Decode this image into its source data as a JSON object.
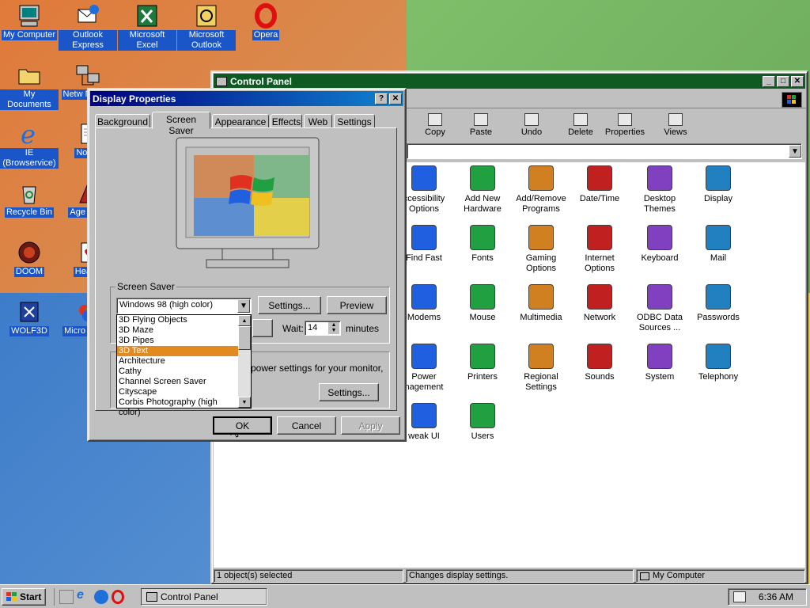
{
  "desktop": {
    "icons": [
      {
        "label": "My Computer",
        "icon": "my-computer-icon"
      },
      {
        "label": "Outlook Express",
        "icon": "outlook-express-icon"
      },
      {
        "label": "Microsoft Excel",
        "icon": "excel-icon"
      },
      {
        "label": "Microsoft Outlook",
        "icon": "outlook-icon"
      },
      {
        "label": "Opera",
        "icon": "opera-icon"
      },
      {
        "label": "My Documents",
        "icon": "folder-icon"
      },
      {
        "label": "Netw Neighb",
        "icon": "network-neighborhood-icon"
      },
      {
        "label": "IE (Browservice)",
        "icon": "ie-icon"
      },
      {
        "label": "Notep",
        "icon": "notepad-icon"
      },
      {
        "label": "Recycle Bin",
        "icon": "recycle-bin-icon"
      },
      {
        "label": "Age Emp",
        "icon": "age-of-empires-icon"
      },
      {
        "label": "DOOM",
        "icon": "doom-icon"
      },
      {
        "label": "Hearts",
        "icon": "hearts-icon"
      },
      {
        "label": "WOLF3D",
        "icon": "wolf3d-icon"
      },
      {
        "label": "Micro Visual",
        "icon": "visual-icon"
      }
    ]
  },
  "control_panel": {
    "title": "Control Panel",
    "toolbar": [
      {
        "label": "Copy",
        "icon": "copy-icon"
      },
      {
        "label": "Paste",
        "icon": "paste-icon"
      },
      {
        "label": "Undo",
        "icon": "undo-icon"
      },
      {
        "label": "Delete",
        "icon": "delete-icon"
      },
      {
        "label": "Properties",
        "icon": "properties-icon"
      },
      {
        "label": "Views",
        "icon": "views-icon"
      }
    ],
    "items": [
      {
        "label": "ccessibility Options",
        "icon": "accessibility-icon"
      },
      {
        "label": "Add New Hardware",
        "icon": "hardware-icon"
      },
      {
        "label": "Add/Remove Programs",
        "icon": "add-remove-icon"
      },
      {
        "label": "Date/Time",
        "icon": "datetime-icon"
      },
      {
        "label": "Desktop Themes",
        "icon": "themes-icon"
      },
      {
        "label": "Display",
        "icon": "display-icon"
      },
      {
        "label": "Find Fast",
        "icon": "find-fast-icon"
      },
      {
        "label": "Fonts",
        "icon": "fonts-icon"
      },
      {
        "label": "Gaming Options",
        "icon": "gaming-icon"
      },
      {
        "label": "Internet Options",
        "icon": "internet-icon"
      },
      {
        "label": "Keyboard",
        "icon": "keyboard-icon"
      },
      {
        "label": "Mail",
        "icon": "mail-icon"
      },
      {
        "label": "Modems",
        "icon": "modem-icon"
      },
      {
        "label": "Mouse",
        "icon": "mouse-icon"
      },
      {
        "label": "Multimedia",
        "icon": "multimedia-icon"
      },
      {
        "label": "Network",
        "icon": "network-icon"
      },
      {
        "label": "ODBC Data Sources ...",
        "icon": "odbc-icon"
      },
      {
        "label": "Passwords",
        "icon": "passwords-icon"
      },
      {
        "label": "Power nagement",
        "icon": "power-icon"
      },
      {
        "label": "Printers",
        "icon": "printers-icon"
      },
      {
        "label": "Regional Settings",
        "icon": "regional-icon"
      },
      {
        "label": "Sounds",
        "icon": "sounds-icon"
      },
      {
        "label": "System",
        "icon": "system-icon"
      },
      {
        "label": "Telephony",
        "icon": "telephony-icon"
      },
      {
        "label": "weak UI",
        "icon": "tweakui-icon"
      },
      {
        "label": "Users",
        "icon": "users-icon"
      }
    ],
    "status": {
      "selected": "1 object(s) selected",
      "desc": "Changes display settings.",
      "location": "My Computer"
    }
  },
  "display_props": {
    "title": "Display Properties",
    "tabs": [
      "Background",
      "Screen Saver",
      "Appearance",
      "Effects",
      "Web",
      "Settings"
    ],
    "active_tab": "Screen Saver",
    "group_label": "Screen Saver",
    "selected_saver": "Windows 98 (high color)",
    "settings_label": "Settings...",
    "preview_label": "Preview",
    "wait_label": "Wait:",
    "wait_value": "14",
    "minutes_label": "minutes",
    "dropdown_options": [
      "3D Flying Objects",
      "3D Maze",
      "3D Pipes",
      "3D Text",
      "Architecture",
      "Cathy",
      "Channel Screen Saver",
      "Cityscape",
      "Corbis Photography (high color)"
    ],
    "highlighted_option": "3D Text",
    "energy_text": "power settings for your monitor,",
    "energy_settings_label": "Settings...",
    "ok": "OK",
    "cancel": "Cancel",
    "apply": "Apply"
  },
  "taskbar": {
    "start": "Start",
    "task": "Control Panel",
    "clock": "6:36 AM"
  }
}
